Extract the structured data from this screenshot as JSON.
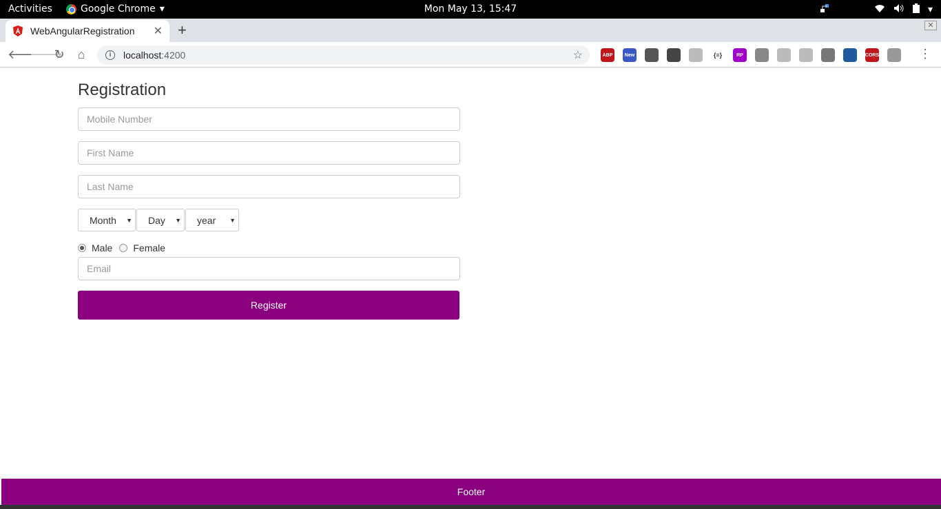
{
  "system": {
    "activities": "Activities",
    "app_name": "Google Chrome",
    "clock": "Mon May 13, 15:47"
  },
  "browser": {
    "tab_title": "WebAngularRegistration",
    "url_host": "localhost",
    "url_port": ":4200",
    "extensions": [
      {
        "name": "ABP",
        "color": "#c0151b"
      },
      {
        "name": "New",
        "color": "#3b57c4"
      },
      {
        "name": "",
        "color": "#555555"
      },
      {
        "name": "",
        "color": "#444444"
      },
      {
        "name": "",
        "color": "#bbbbbb"
      },
      {
        "name": "{≡}",
        "color": "#ffffff"
      },
      {
        "name": "RP",
        "color": "#a000c8"
      },
      {
        "name": "",
        "color": "#888888"
      },
      {
        "name": "",
        "color": "#bbbbbb"
      },
      {
        "name": "",
        "color": "#bbbbbb"
      },
      {
        "name": "",
        "color": "#777777"
      },
      {
        "name": "",
        "color": "#1e5a9c"
      },
      {
        "name": "CORS",
        "color": "#c0151b"
      },
      {
        "name": "",
        "color": "#999999"
      }
    ]
  },
  "form": {
    "title": "Registration",
    "mobile_placeholder": "Mobile Number",
    "first_name_placeholder": "First Name",
    "last_name_placeholder": "Last Name",
    "month": "Month",
    "day": "Day",
    "year": "year",
    "gender_male": "Male",
    "gender_female": "Female",
    "gender_selected": "Male",
    "email_placeholder": "Email",
    "register_label": "Register"
  },
  "footer": {
    "text": "Footer"
  },
  "colors": {
    "accent": "#8b007f"
  }
}
